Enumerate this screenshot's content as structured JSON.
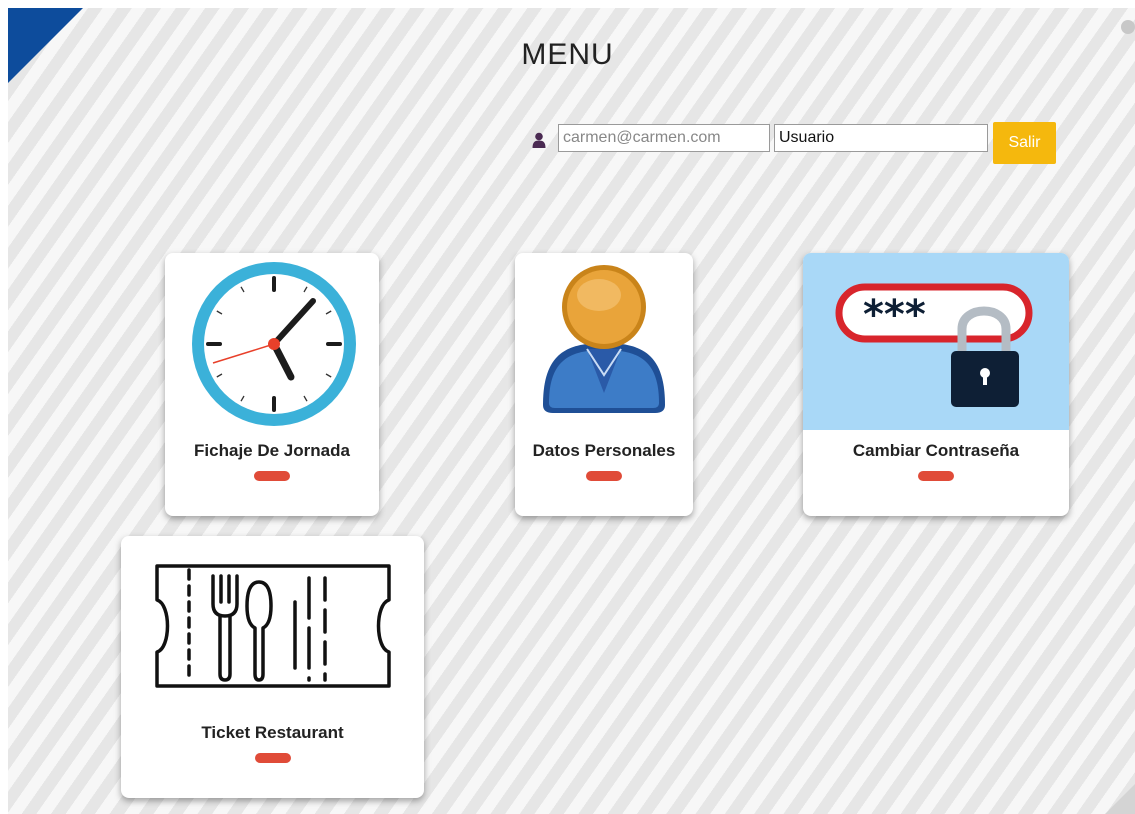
{
  "header": {
    "title": "MENU"
  },
  "user_bar": {
    "user_icon": "user-icon",
    "email_placeholder": "carmen@carmen.com",
    "role_value": "Usuario",
    "logout_label": "Salir"
  },
  "cards": [
    {
      "label": "Fichaje De Jornada",
      "icon": "clock-icon"
    },
    {
      "label": "Datos Personales",
      "icon": "person-icon"
    },
    {
      "label": "Cambiar Contraseña",
      "icon": "password-lock-icon"
    },
    {
      "label": "Ticket Restaurant",
      "icon": "meal-ticket-icon"
    }
  ],
  "password_icon_text": "***",
  "colors": {
    "corner_accent": "#0d4c9c",
    "logout_button": "#f5b80d",
    "card_pill": "#e04b38",
    "password_card_bg": "#a9d8f7"
  }
}
